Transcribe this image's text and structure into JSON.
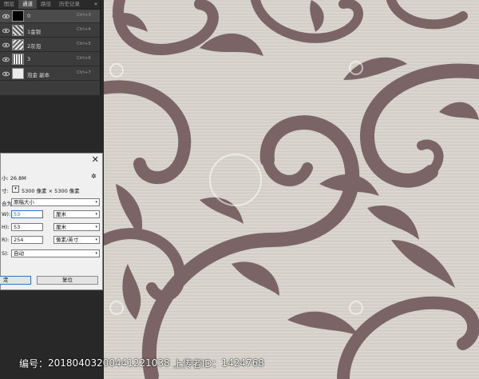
{
  "panel": {
    "tabs": [
      "图层",
      "通道",
      "路径",
      "历史记录"
    ],
    "active_tab": "通道",
    "collapse_glyph": "«",
    "channels": [
      {
        "name": "0",
        "shortcut": "Ctrl+3",
        "thumb": "black",
        "selected": true
      },
      {
        "name": "1金银",
        "shortcut": "Ctrl+4",
        "thumb": "noise",
        "selected": false
      },
      {
        "name": "2灰泡",
        "shortcut": "Ctrl+5",
        "thumb": "noise",
        "selected": false
      },
      {
        "name": "3",
        "shortcut": "Ctrl+6",
        "thumb": "noise",
        "selected": false
      },
      {
        "name": "泡金 副本",
        "shortcut": "Ctrl+7",
        "thumb": "light",
        "selected": false
      }
    ]
  },
  "dialog": {
    "size_label": "小: ",
    "size_value": "26.8M",
    "dims_label": "寸:",
    "dims_value": "5300 像素 × 5300 像素",
    "fit_label": "合为:",
    "fit_value": "原稿大小",
    "width_label": "W):",
    "width_value": "53",
    "width_unit": "厘米",
    "height_label": "H):",
    "height_value": "53",
    "height_unit": "厘米",
    "res_label": "R):",
    "res_value": "254",
    "res_unit": "像素/英寸",
    "resample_label": "S):",
    "resample_value": "自动",
    "ok_label": "定",
    "reset_label": "复位",
    "close_glyph": "✕",
    "gear_glyph": "✲"
  },
  "watermark": {
    "id_label": "编号：",
    "id_value": "20180403200441221038",
    "uploader_label": "上传者ID：",
    "uploader_value": "1424768"
  },
  "colors": {
    "canvas_bg": "#d6d2cb",
    "ornament": "#7a6466",
    "panel_bg": "#3c3c3c",
    "accent": "#2f6fd6"
  }
}
